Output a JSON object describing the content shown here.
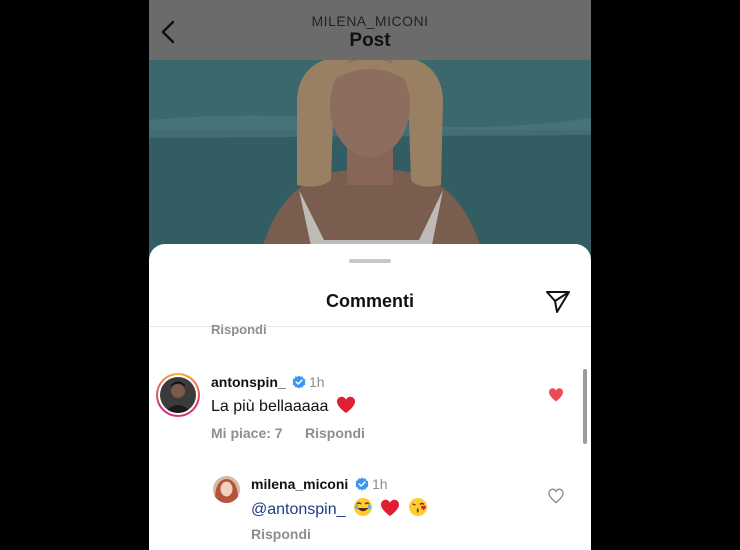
{
  "header": {
    "username": "MILENA_MICONI",
    "title": "Post"
  },
  "sheet": {
    "title": "Commenti",
    "prev_reply_label": "Rispondi"
  },
  "comments": [
    {
      "username": "antonspin_",
      "verified": true,
      "time": "1h",
      "text": "La più bellaaaaa",
      "likes_label": "Mi piace: 7",
      "reply_label": "Rispondi",
      "liked": true
    },
    {
      "username": "milena_miconi",
      "verified": true,
      "time": "1h",
      "mention": "@antonspin_",
      "reply_label": "Rispondi",
      "liked": false
    }
  ],
  "colors": {
    "like_red": "#ed4956",
    "verified_blue": "#3897f0",
    "muted_gray": "#8e8e8e"
  },
  "icons": [
    "back-chevron-icon",
    "send-icon",
    "verified-badge-icon",
    "heart-filled-icon",
    "heart-outline-icon",
    "heart-emoji",
    "laughing-emoji",
    "kiss-emoji"
  ]
}
